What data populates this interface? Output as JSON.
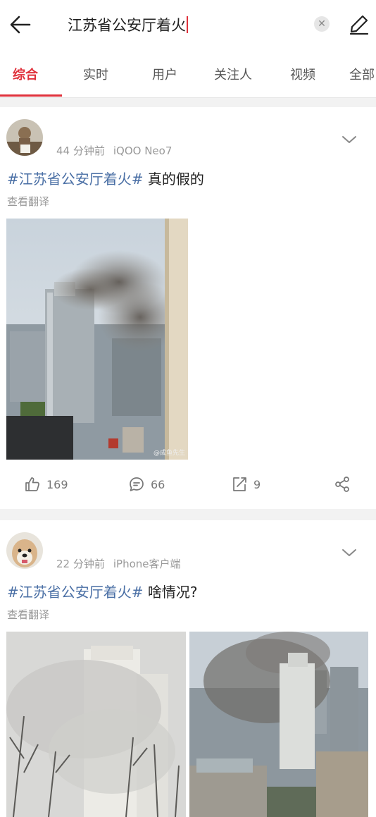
{
  "search": {
    "query": "江苏省公安厅着火"
  },
  "tabs": [
    "综合",
    "实时",
    "用户",
    "关注人",
    "视频",
    "全部"
  ],
  "posts": [
    {
      "time": "44 分钟前",
      "device": "iQOO Neo7",
      "hashtag": "#江苏省公安厅着火#",
      "text": " 真的假的",
      "translate": "查看翻译",
      "watermark": "@成鱼先生",
      "likes": "169",
      "comments": "66",
      "reposts": "9"
    },
    {
      "time": "22 分钟前",
      "device": "iPhone客户端",
      "hashtag": "#江苏省公安厅着火#",
      "text": " 啥情况?",
      "translate": "查看翻译"
    }
  ],
  "colors": {
    "accent": "#e0323c",
    "link": "#4a6fa5"
  }
}
